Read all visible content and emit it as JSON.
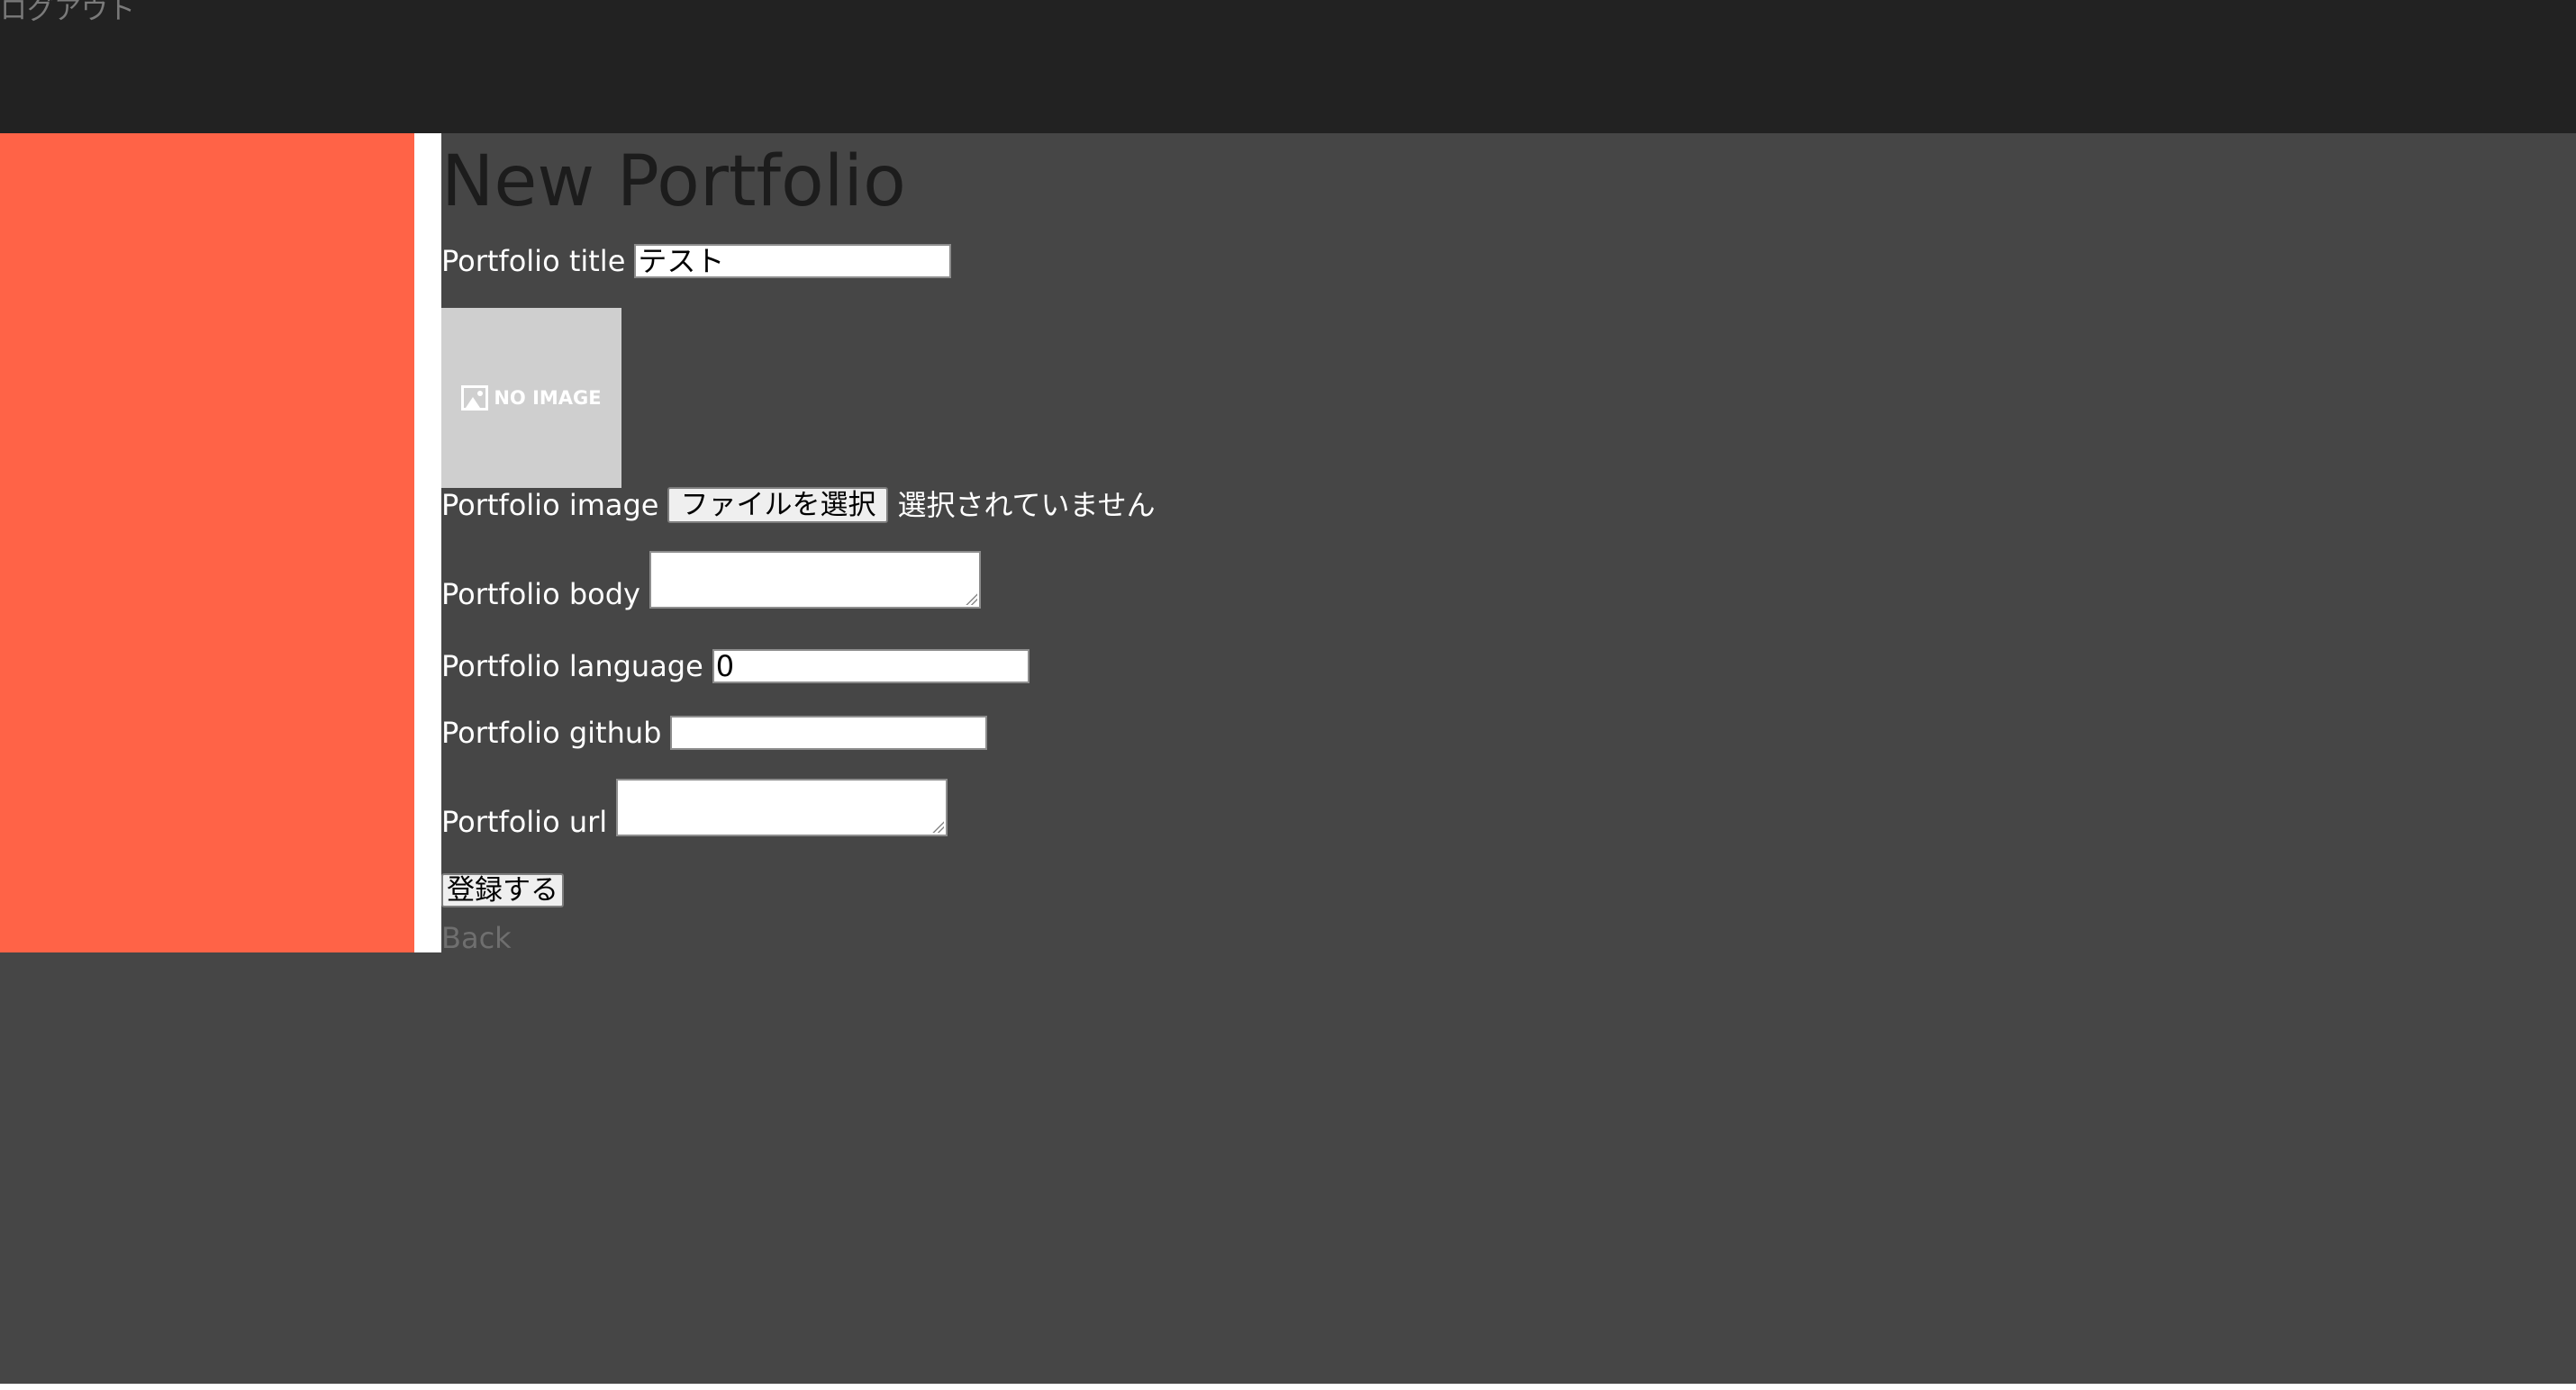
{
  "header": {
    "logout_label": "ログアウト"
  },
  "page": {
    "title": "New Portfolio"
  },
  "form": {
    "title_label": "Portfolio title",
    "title_value": "テスト",
    "image_placeholder_text": "NO IMAGE",
    "image_label": "Portfolio image",
    "file_button_label": "ファイルを選択",
    "file_status": "選択されていません",
    "body_label": "Portfolio body",
    "body_value": "",
    "language_label": "Portfolio language",
    "language_value": "0",
    "github_label": "Portfolio github",
    "github_value": "",
    "url_label": "Portfolio url",
    "url_value": "",
    "submit_label": "登録する",
    "back_label": "Back"
  },
  "colors": {
    "topbar": "#222222",
    "main_background": "#464646",
    "sidebar": "#ff6347",
    "link_muted": "#7a7a7a"
  },
  "icons": {
    "no_image": "image-placeholder-icon",
    "textarea_resize": "resize-grip-icon"
  }
}
